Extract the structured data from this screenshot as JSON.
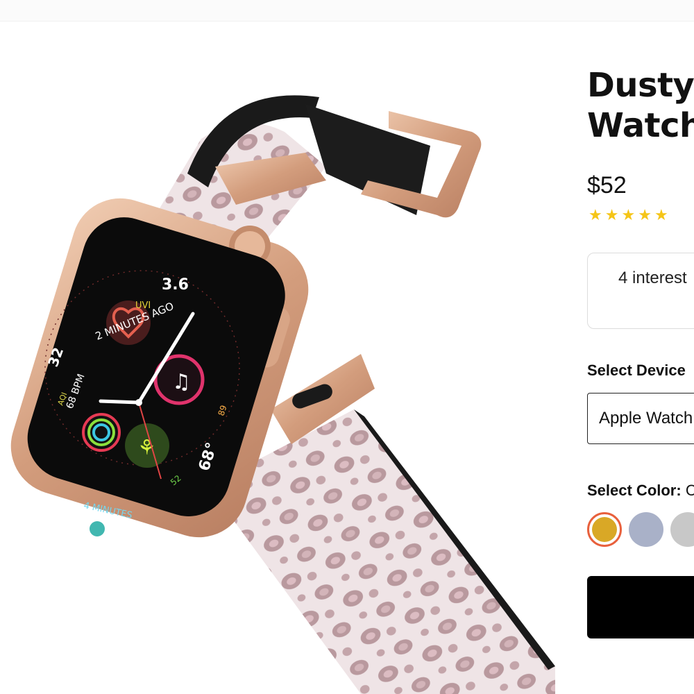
{
  "product": {
    "title": "Dusty Watch",
    "title_line1": "Dusty",
    "title_line2": "Watch",
    "price": "$52",
    "rating": 5,
    "info_text": "4 interest"
  },
  "device": {
    "label": "Select Device",
    "selected": "Apple Watch"
  },
  "color": {
    "label": "Select Color:",
    "label_suffix": "C",
    "swatches": [
      {
        "name": "gold",
        "hex": "#d9a826",
        "selected": true
      },
      {
        "name": "lavender-grey",
        "hex": "#a9b1c8",
        "selected": false
      },
      {
        "name": "silver",
        "hex": "#c8c8c8",
        "selected": false
      }
    ]
  },
  "image": {
    "watch_face": {
      "top_value": "3.6",
      "uvi_label": "UVI",
      "minutes_ago_text": "2 MINUTES AGO",
      "left_value": "32",
      "bpm_text": "68 BPM",
      "aqi_label": "AQI",
      "right_temp": "68°",
      "right_low": "52",
      "right_high": "89",
      "bottom_text": "4 MINUTES"
    }
  }
}
